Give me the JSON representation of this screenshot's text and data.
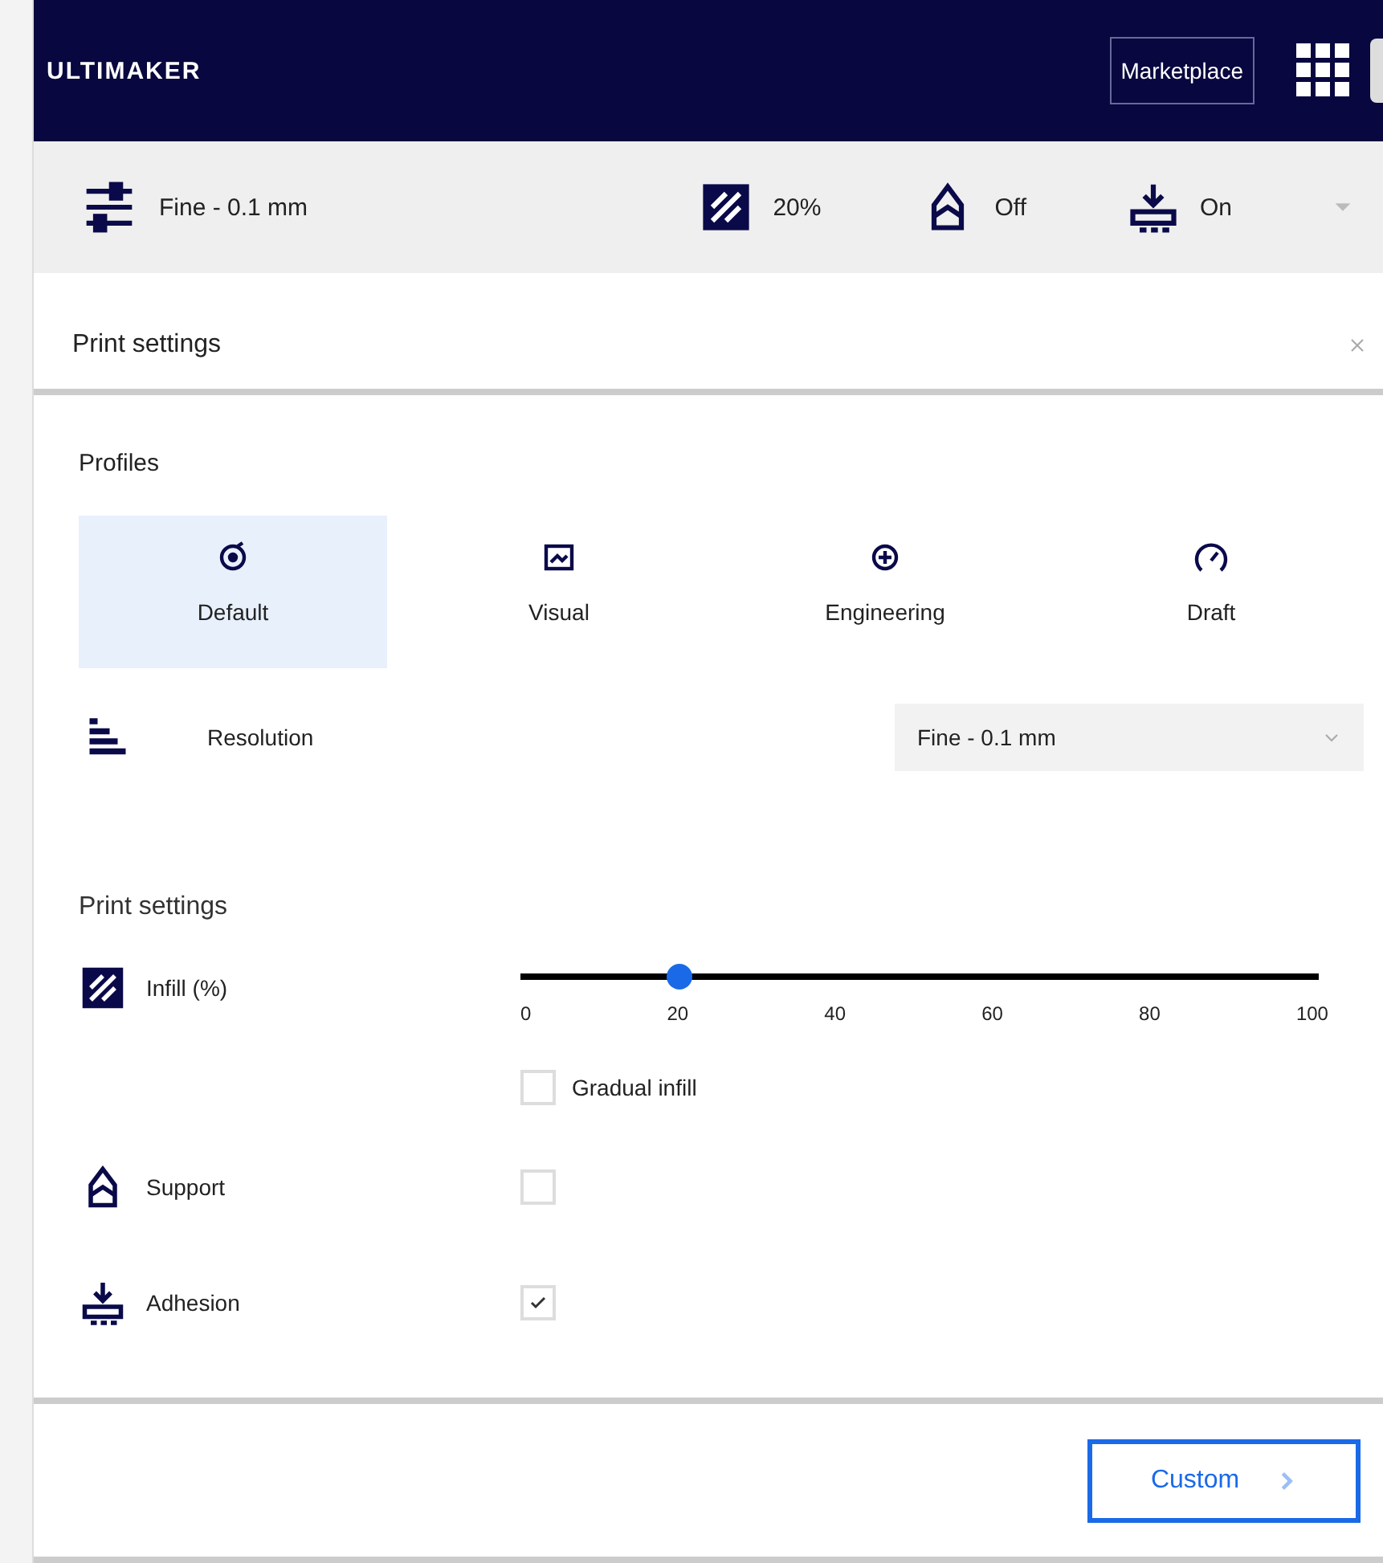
{
  "header": {
    "logo": "ULTIMAKER",
    "marketplace_button": "Marketplace"
  },
  "toolbar": {
    "profile": "Fine - 0.1 mm",
    "infill": "20%",
    "support": "Off",
    "adhesion": "On"
  },
  "panel": {
    "title": "Print settings",
    "profiles_label": "Profiles",
    "profiles": [
      {
        "label": "Default",
        "selected": true
      },
      {
        "label": "Visual",
        "selected": false
      },
      {
        "label": "Engineering",
        "selected": false
      },
      {
        "label": "Draft",
        "selected": false
      }
    ],
    "resolution": {
      "label": "Resolution",
      "value": "Fine - 0.1 mm"
    },
    "section_title": "Print settings",
    "infill": {
      "label": "Infill (%)",
      "level": 0.2,
      "ticks": [
        "0",
        "20",
        "40",
        "60",
        "80",
        "100"
      ],
      "gradual": {
        "label": "Gradual infill",
        "checked": false
      }
    },
    "support": {
      "label": "Support",
      "checked": false
    },
    "adhesion": {
      "label": "Adhesion",
      "checked": true
    },
    "custom_button": "Custom"
  }
}
